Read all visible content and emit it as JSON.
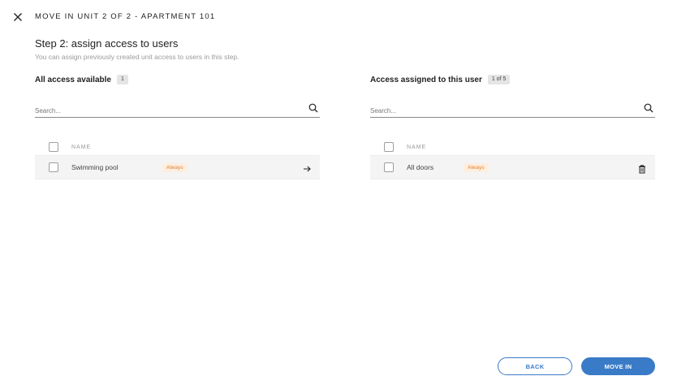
{
  "header": {
    "close_icon": "close-icon",
    "title": "MOVE IN UNIT 2 OF 2 - APARTMENT 101"
  },
  "step": {
    "title": "Step 2: assign access to users",
    "subtitle": "You can assign previously created unit access to users in this step."
  },
  "available": {
    "title": "All access available",
    "count": "1",
    "search_placeholder": "Search...",
    "column_name": "NAME",
    "rows": [
      {
        "name": "Swimming pool",
        "tag": "Always",
        "action_icon": "arrow-right-icon"
      }
    ]
  },
  "assigned": {
    "title": "Access assigned to this user",
    "count": "1 of 5",
    "search_placeholder": "Search...",
    "column_name": "NAME",
    "rows": [
      {
        "name": "All doors",
        "tag": "Always",
        "action_icon": "trash-icon"
      }
    ]
  },
  "footer": {
    "back_label": "BACK",
    "move_in_label": "MOVE IN"
  },
  "colors": {
    "primary": "#3a7bc8",
    "tag_bg": "#fdeee0",
    "tag_text": "#e5802b",
    "row_bg": "#f4f4f4"
  }
}
